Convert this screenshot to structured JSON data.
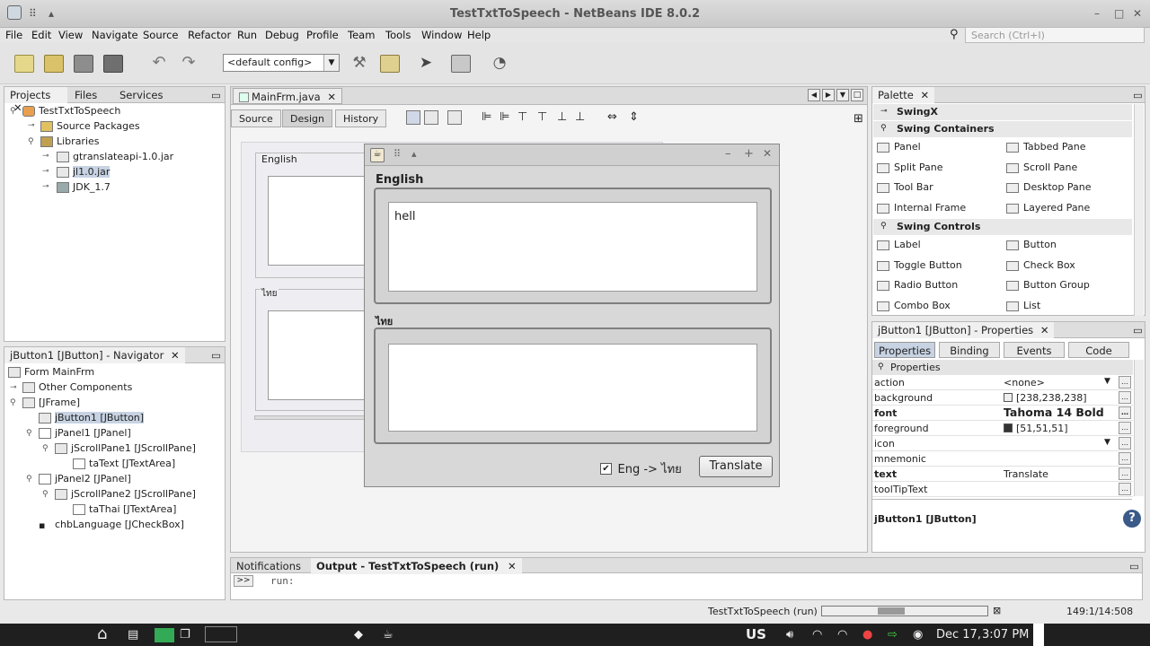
{
  "window": {
    "title": "TestTxtToSpeech - NetBeans IDE 8.0.2"
  },
  "menu": [
    "File",
    "Edit",
    "View",
    "Navigate",
    "Source",
    "Refactor",
    "Run",
    "Debug",
    "Profile",
    "Team",
    "Tools",
    "Window",
    "Help"
  ],
  "search": {
    "placeholder": "Search (Ctrl+I)"
  },
  "toolbar": {
    "config": "<default config>"
  },
  "projects": {
    "tabs": [
      "Projects",
      "Files",
      "Services"
    ],
    "root": "TestTxtToSpeech",
    "items": [
      "Source Packages",
      "Libraries",
      "gtranslateapi-1.0.jar",
      "jl1.0.jar",
      "JDK_1.7"
    ]
  },
  "navigator": {
    "title": "jButton1 [JButton] - Navigator",
    "items": [
      "Form MainFrm",
      "Other Components",
      "[JFrame]",
      "jButton1 [JButton]",
      "jPanel1 [JPanel]",
      "jScrollPane1 [JScrollPane]",
      "taText [JTextArea]",
      "jPanel2 [JPanel]",
      "jScrollPane2 [JScrollPane]",
      "taThai [JTextArea]",
      "chbLanguage [JCheckBox]"
    ]
  },
  "editor": {
    "file_tab": "MainFrm.java",
    "subtabs": [
      "Source",
      "Design",
      "History"
    ],
    "designer": {
      "label1": "English",
      "label2": "ไทย"
    }
  },
  "dialog": {
    "section1": "English",
    "text1": "hell",
    "section2": "ไทย",
    "checkbox_label": "Eng -> ไทย",
    "checkbox_checked": true,
    "button": "Translate"
  },
  "palette": {
    "title": "Palette",
    "groups": [
      {
        "name": "SwingX"
      },
      {
        "name": "Swing Containers",
        "items": [
          "Panel",
          "Tabbed Pane",
          "Split Pane",
          "Scroll Pane",
          "Tool Bar",
          "Desktop Pane",
          "Internal Frame",
          "Layered Pane"
        ]
      },
      {
        "name": "Swing Controls",
        "items": [
          "Label",
          "Button",
          "Toggle Button",
          "Check Box",
          "Radio Button",
          "Button Group",
          "Combo Box",
          "List"
        ]
      }
    ]
  },
  "properties": {
    "title": "jButton1 [JButton] - Properties",
    "tabs": [
      "Properties",
      "Binding",
      "Events",
      "Code"
    ],
    "section": "Properties",
    "rows": [
      {
        "k": "action",
        "v": "<none>"
      },
      {
        "k": "background",
        "v": "[238,238,238]"
      },
      {
        "k": "font",
        "v": "Tahoma 14 Bold"
      },
      {
        "k": "foreground",
        "v": "[51,51,51]"
      },
      {
        "k": "icon",
        "v": ""
      },
      {
        "k": "mnemonic",
        "v": ""
      },
      {
        "k": "text",
        "v": "Translate"
      },
      {
        "k": "toolTipText",
        "v": ""
      }
    ],
    "footer": "jButton1 [JButton]"
  },
  "output": {
    "tabs": [
      "Notifications",
      "Output - TestTxtToSpeech (run)"
    ],
    "log": "run:"
  },
  "statusbar": {
    "task": "TestTxtToSpeech (run)",
    "position": "149:1/14:508"
  },
  "taskbar": {
    "keyboard": "US",
    "date": "Dec 17,",
    "time": "3:07 PM"
  }
}
